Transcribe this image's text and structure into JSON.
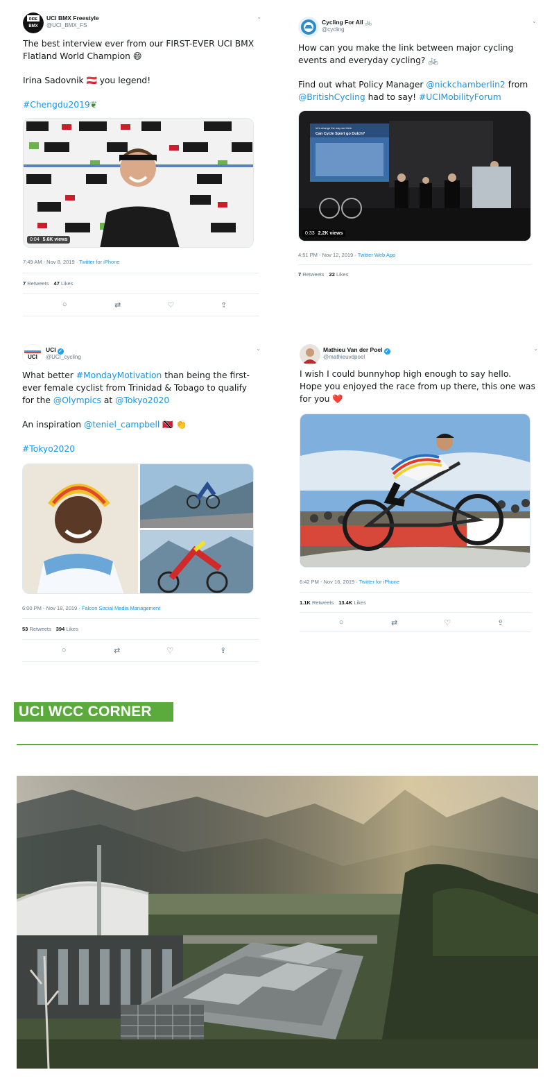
{
  "tweets": [
    {
      "name": "UCI BMX Freestyle",
      "handle": "@UCI_BMX_FS",
      "paragraphs": [
        "The best interview ever from our FIRST-EVER UCI BMX Flatland World Champion 😄",
        "Irina Sadovnik 🇦🇹 you legend!",
        "#Chengdu2019"
      ],
      "video_time": "0:04",
      "video_views": "5.6K views",
      "time": "7:49 AM - Nov 8, 2019",
      "source": "Twitter for iPhone",
      "retweets": "7",
      "retweets_label": "Retweets",
      "likes": "47",
      "likes_label": "Likes"
    },
    {
      "name": "Cycling For All 🚲",
      "handle": "@cycling",
      "p1": "How can you make the link between major cycling events and everyday cycling? 🚲",
      "p2_pre": "Find out what Policy Manager ",
      "p2_link1": "@nickchamberlin2",
      "p2_mid1": " from ",
      "p2_link2": "@BritishCycling",
      "p2_mid2": " had to say! ",
      "p2_link3": "#UCIMobilityForum",
      "slide_line1": "let's change the way we think",
      "slide_line2": "Can Cycle Sport go Dutch?",
      "video_time": "0:33",
      "video_views": "2.2K views",
      "time": "4:51 PM - Nov 12, 2019",
      "source": "Twitter Web App",
      "retweets": "7",
      "retweets_label": "Retweets",
      "likes": "22",
      "likes_label": "Likes"
    },
    {
      "name": "UCI",
      "handle": "@UCI_cycling",
      "p1_pre": "What better ",
      "p1_link1": "#MondayMotivation",
      "p1_mid1": " than being the first-ever female cyclist from Trinidad & Tobago to qualify for the ",
      "p1_link2": "@Olympics",
      "p1_mid2": " at ",
      "p1_link3": "@Tokyo2020",
      "p2_pre": "An inspiration ",
      "p2_link": "@teniel_campbell",
      "p2_post": " 🇹🇹 👏",
      "p3_link": "#Tokyo2020",
      "time": "6:00 PM - Nov 18, 2019",
      "source": "Falcon Social Media Management",
      "retweets": "53",
      "retweets_label": "Retweets",
      "likes": "394",
      "likes_label": "Likes"
    },
    {
      "name": "Mathieu Van der Poel",
      "handle": "@mathieuvdpoel",
      "text": "I wish I could bunnyhop high enough to say hello. Hope you enjoyed the race from up there, this one was for you ❤️",
      "time": "6:42 PM - Nov 16, 2019",
      "source": "Twitter for iPhone",
      "retweets": "1.1K",
      "retweets_label": "Retweets",
      "likes": "13.4K",
      "likes_label": "Likes"
    }
  ],
  "section": {
    "title": "UCI WCC CORNER",
    "accent": "#5aaa3c"
  },
  "colors": {
    "link": "#1b95e0",
    "text": "#14171a",
    "muted": "#657786"
  },
  "icons": [
    "chevron-down-icon",
    "verified-badge-icon",
    "reply-icon",
    "retweet-icon",
    "like-icon",
    "share-icon"
  ]
}
